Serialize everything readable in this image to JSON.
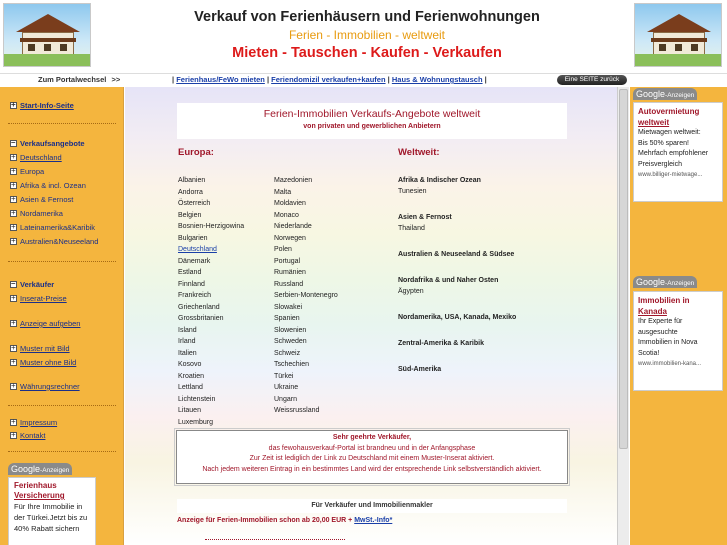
{
  "header": {
    "title": "Verkauf von Ferienhäusern und Ferienwohnungen",
    "subtitle": "Ferien - Immobilien - weltweit",
    "tagline": "Mieten - Tauschen - Kaufen - Verkaufen"
  },
  "nav": {
    "portal_label": "Zum Portalwechsel",
    "portal_arrow": ">>",
    "sep": "|",
    "links": [
      "Ferienhaus/FeWo mieten",
      "Feriendomizil verkaufen+kaufen",
      "Haus & Wohnungstausch"
    ],
    "back_button": "Eine SEITE zurück"
  },
  "sidebar": {
    "start": "Start-Info-Seite",
    "section1": "Verkaufsangebote",
    "regions": [
      "Deutschland",
      "Europa",
      "Afrika & incl. Ozean",
      "Asien & Fernost",
      "Nordamerika",
      "Lateinamerika&Karibik",
      "Australien&Neuseeland"
    ],
    "section2": "Verkäufer",
    "seller_items": [
      "Inserat-Preise",
      "Anzeige aufgeben",
      "Muster mit Bild",
      "Muster ohne Bild",
      "Währungsrechner"
    ],
    "info_items": [
      "Impressum",
      "Kontakt"
    ],
    "ad": {
      "badge": "Google",
      "badge_suffix": "-Anzeigen",
      "title_line1": "Ferienhaus",
      "title_line2": "Versicherung",
      "text": [
        "Für Ihre Immobilie in",
        "der Türkei.Jetzt bis zu",
        "40% Rabatt sichern"
      ]
    }
  },
  "main": {
    "title": "Ferien-Immobilien Verkaufs-Angebote weltweit",
    "subtitle": "von privaten und gewerblichen Anbietern",
    "europe_heading": "Europa:",
    "world_heading": "Weltweit:",
    "europe_col1": [
      "Albanien",
      "Andorra",
      "Österreich",
      "Belgien",
      "Bosnien-Herzigowina",
      "Bulgarien",
      "Deutschland",
      "Dänemark",
      "Estland",
      "Finnland",
      "Frankreich",
      "Griechenland",
      "Grossbritanien",
      "Island",
      "Irland",
      "Italien",
      "Kosovo",
      "Kroatien",
      "Lettland",
      "Lichtenstein",
      "Litauen",
      "Luxemburg"
    ],
    "europe_col2": [
      "Mazedonien",
      "Malta",
      "Moldavien",
      "Monaco",
      "Niederlande",
      "Norwegen",
      "Polen",
      "Portugal",
      "Rumänien",
      "Russland",
      "Serbien-Montenegro",
      "Slowakei",
      "Spanien",
      "Slowenien",
      "Schweden",
      "Schweiz",
      "Tschechien",
      "Türkei",
      "Ukraine",
      "Ungarn",
      "Weissrussland"
    ],
    "world": [
      {
        "region": "Afrika & Indischer Ozean",
        "countries": "Tunesien"
      },
      {
        "region": "Asien & Fernost",
        "countries": "Thailand"
      },
      {
        "region": "Australien & Neuseeland & Südsee",
        "countries": ""
      },
      {
        "region": "Nordafrika & und Naher Osten",
        "countries": "Ägypten"
      },
      {
        "region": "Nordamerika, USA, Kanada, Mexiko",
        "countries": ""
      },
      {
        "region": "Zentral-Amerika & Karibik",
        "countries": ""
      },
      {
        "region": "Süd-Amerika",
        "countries": ""
      }
    ],
    "notice": {
      "heading": "Sehr geehrte Verkäufer,",
      "lines": [
        "das fewohausverkauf-Portal ist brandneu und in der Anfangsphase",
        "Zur Zeit ist lediglich der Link zu Deutschland mit einem Muster-Inserat aktiviert.",
        "Nach jedem weiteren Eintrag in ein bestimmtes Land wird der entsprechende Link selbstverständlich aktiviert."
      ]
    },
    "sellers_bar": "Für Verkäufer und Immobilienmakler",
    "price_text": "Anzeige für Ferien-Immobilien schon ab 20,00 EUR +",
    "price_link": "MwSt.-Info*"
  },
  "right_ads": [
    {
      "badge": "Google",
      "badge_suffix": "-Anzeigen",
      "title_line1": "Autovermietung",
      "title_line2": "weltweit",
      "text": [
        "Mietwagen weltweit:",
        "Bis 50% sparen!",
        "Mehrfach empfohlener",
        "Preisvergleich"
      ],
      "url": "www.billiger-mietwage..."
    },
    {
      "badge": "Google",
      "badge_suffix": "-Anzeigen",
      "title_line1": "Immobilien in",
      "title_line2": "Kanada",
      "text": [
        "Ihr Experte für",
        "ausgesuchte",
        "Immobilien in Nova",
        "Scotia!"
      ],
      "url": "www.immobilien-kana..."
    }
  ]
}
